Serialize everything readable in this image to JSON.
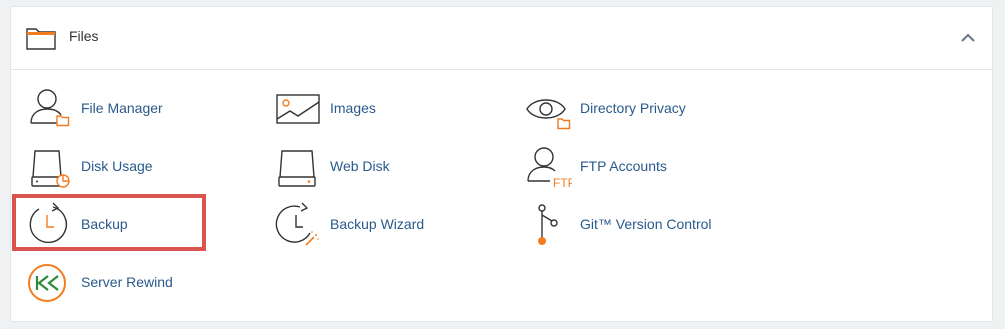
{
  "section": {
    "title": "Files",
    "collapse_icon": "chevron-up-icon"
  },
  "items": [
    {
      "label": "File Manager",
      "icon": "file-manager-icon"
    },
    {
      "label": "Images",
      "icon": "images-icon"
    },
    {
      "label": "Directory Privacy",
      "icon": "directory-privacy-icon"
    },
    {
      "label": "Disk Usage",
      "icon": "disk-usage-icon"
    },
    {
      "label": "Web Disk",
      "icon": "web-disk-icon"
    },
    {
      "label": "FTP Accounts",
      "icon": "ftp-accounts-icon",
      "icon_text": "FTP"
    },
    {
      "label": "Backup",
      "icon": "backup-icon",
      "highlighted": true
    },
    {
      "label": "Backup Wizard",
      "icon": "backup-wizard-icon"
    },
    {
      "label": "Git™ Version Control",
      "icon": "git-icon"
    },
    {
      "label": "Server Rewind",
      "icon": "server-rewind-icon"
    }
  ],
  "colors": {
    "accent_orange": "#f47c20",
    "icon_dark": "#333333",
    "link_blue": "#295a8c",
    "rewind_green": "#2e8b3a",
    "highlight_red": "#d9534f"
  }
}
